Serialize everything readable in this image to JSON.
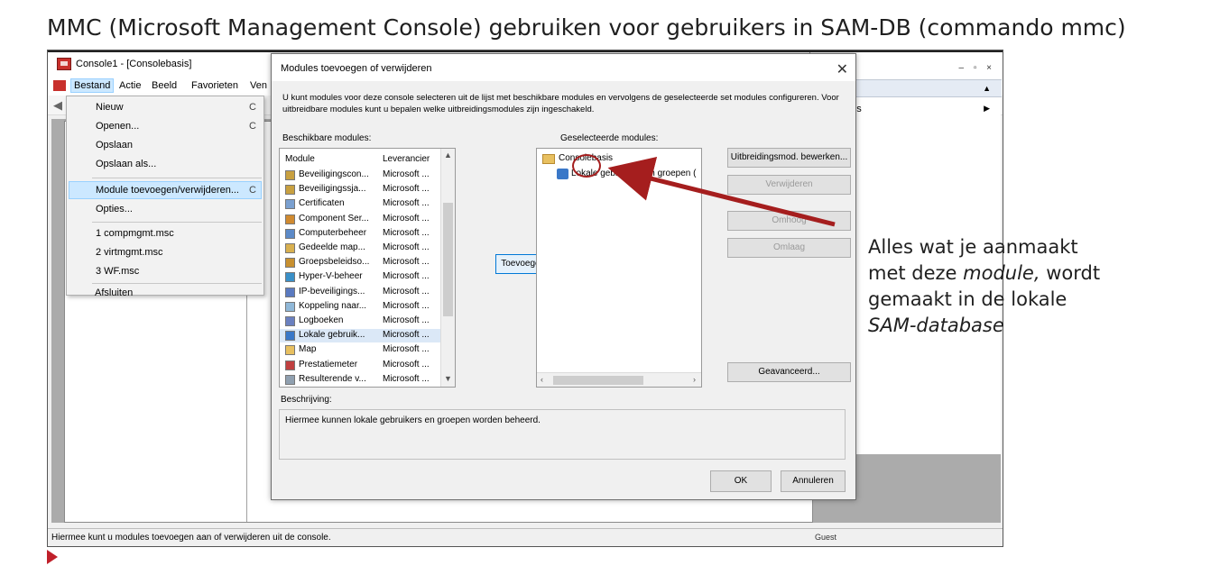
{
  "slide": {
    "title": "MMC (Microsoft Management Console) gebruiken voor gebruikers in SAM-DB (commando mmc)",
    "callout_line1": "Alles wat je aanmaakt",
    "callout_line2a": "met deze ",
    "callout_line2b": "module,",
    "callout_line2c": " wordt",
    "callout_line3": "gemaakt in de lokale",
    "callout_line4": "SAM-database"
  },
  "window": {
    "title": "Console1 - [Consolebasis]",
    "minimize": "—",
    "maximize": "☐",
    "close": "✕",
    "inner_controls": "– ▫ ×"
  },
  "menubar": {
    "items": [
      "Bestand",
      "Actie",
      "Beeld",
      "Favorieten",
      "Ven"
    ]
  },
  "file_menu": {
    "items": [
      "Nieuw",
      "Openen...",
      "Opslaan",
      "Opslaan als...",
      "Module toevoegen/verwijderen...",
      "Opties...",
      "1 compmgmt.msc",
      "2 virtmgmt.msc",
      "3 WF.msc",
      "Afsluiten"
    ],
    "shortcut_hint": "C"
  },
  "actions_pane": {
    "header": "asis",
    "more": "acties"
  },
  "statusbar": {
    "text": "Hiermee kunt u modules toevoegen aan of verwijderen uit de console.",
    "tray": "Guest"
  },
  "dialog": {
    "title": "Modules toevoegen of verwijderen",
    "close": "✕",
    "intro": "U kunt modules voor deze console selecteren uit de lijst met beschikbare modules en vervolgens de geselecteerde set modules configureren. Voor uitbreidbare modules kunt u bepalen welke uitbreidingsmodules zijn ingeschakeld.",
    "available_label": "Beschikbare modules:",
    "selected_label": "Geselecteerde modules:",
    "col_module": "Module",
    "col_vendor": "Leverancier",
    "available": [
      {
        "name": "Beveiligingscon...",
        "vendor": "Microsoft ..."
      },
      {
        "name": "Beveiligingssja...",
        "vendor": "Microsoft ..."
      },
      {
        "name": "Certificaten",
        "vendor": "Microsoft ..."
      },
      {
        "name": "Component Ser...",
        "vendor": "Microsoft ..."
      },
      {
        "name": "Computerbeheer",
        "vendor": "Microsoft ..."
      },
      {
        "name": "Gedeelde map...",
        "vendor": "Microsoft ..."
      },
      {
        "name": "Groepsbeleidso...",
        "vendor": "Microsoft ..."
      },
      {
        "name": "Hyper-V-beheer",
        "vendor": "Microsoft ..."
      },
      {
        "name": "IP-beveiligings...",
        "vendor": "Microsoft ..."
      },
      {
        "name": "Koppeling naar...",
        "vendor": "Microsoft ..."
      },
      {
        "name": "Logboeken",
        "vendor": "Microsoft ..."
      },
      {
        "name": "Lokale gebruik...",
        "vendor": "Microsoft ..."
      },
      {
        "name": "Map",
        "vendor": "Microsoft ..."
      },
      {
        "name": "Prestatiemeter",
        "vendor": "Microsoft ..."
      },
      {
        "name": "Resulterende v...",
        "vendor": "Microsoft ..."
      }
    ],
    "add_button": "Toevoegen >",
    "selected_root": "Consolebasis",
    "selected_child": "Lokale gebruikers en groepen (",
    "btn_extensions": "Uitbreidingsmod. bewerken...",
    "btn_remove": "Verwijderen",
    "btn_up": "Omhoog",
    "btn_down": "Omlaag",
    "btn_advanced": "Geavanceerd...",
    "description_label": "Beschrijving:",
    "description": "Hiermee kunnen lokale gebruikers en groepen worden beheerd.",
    "ok": "OK",
    "cancel": "Annuleren"
  },
  "colors": {
    "annotation_red": "#a51e1e",
    "selection_blue": "#cce8ff"
  }
}
